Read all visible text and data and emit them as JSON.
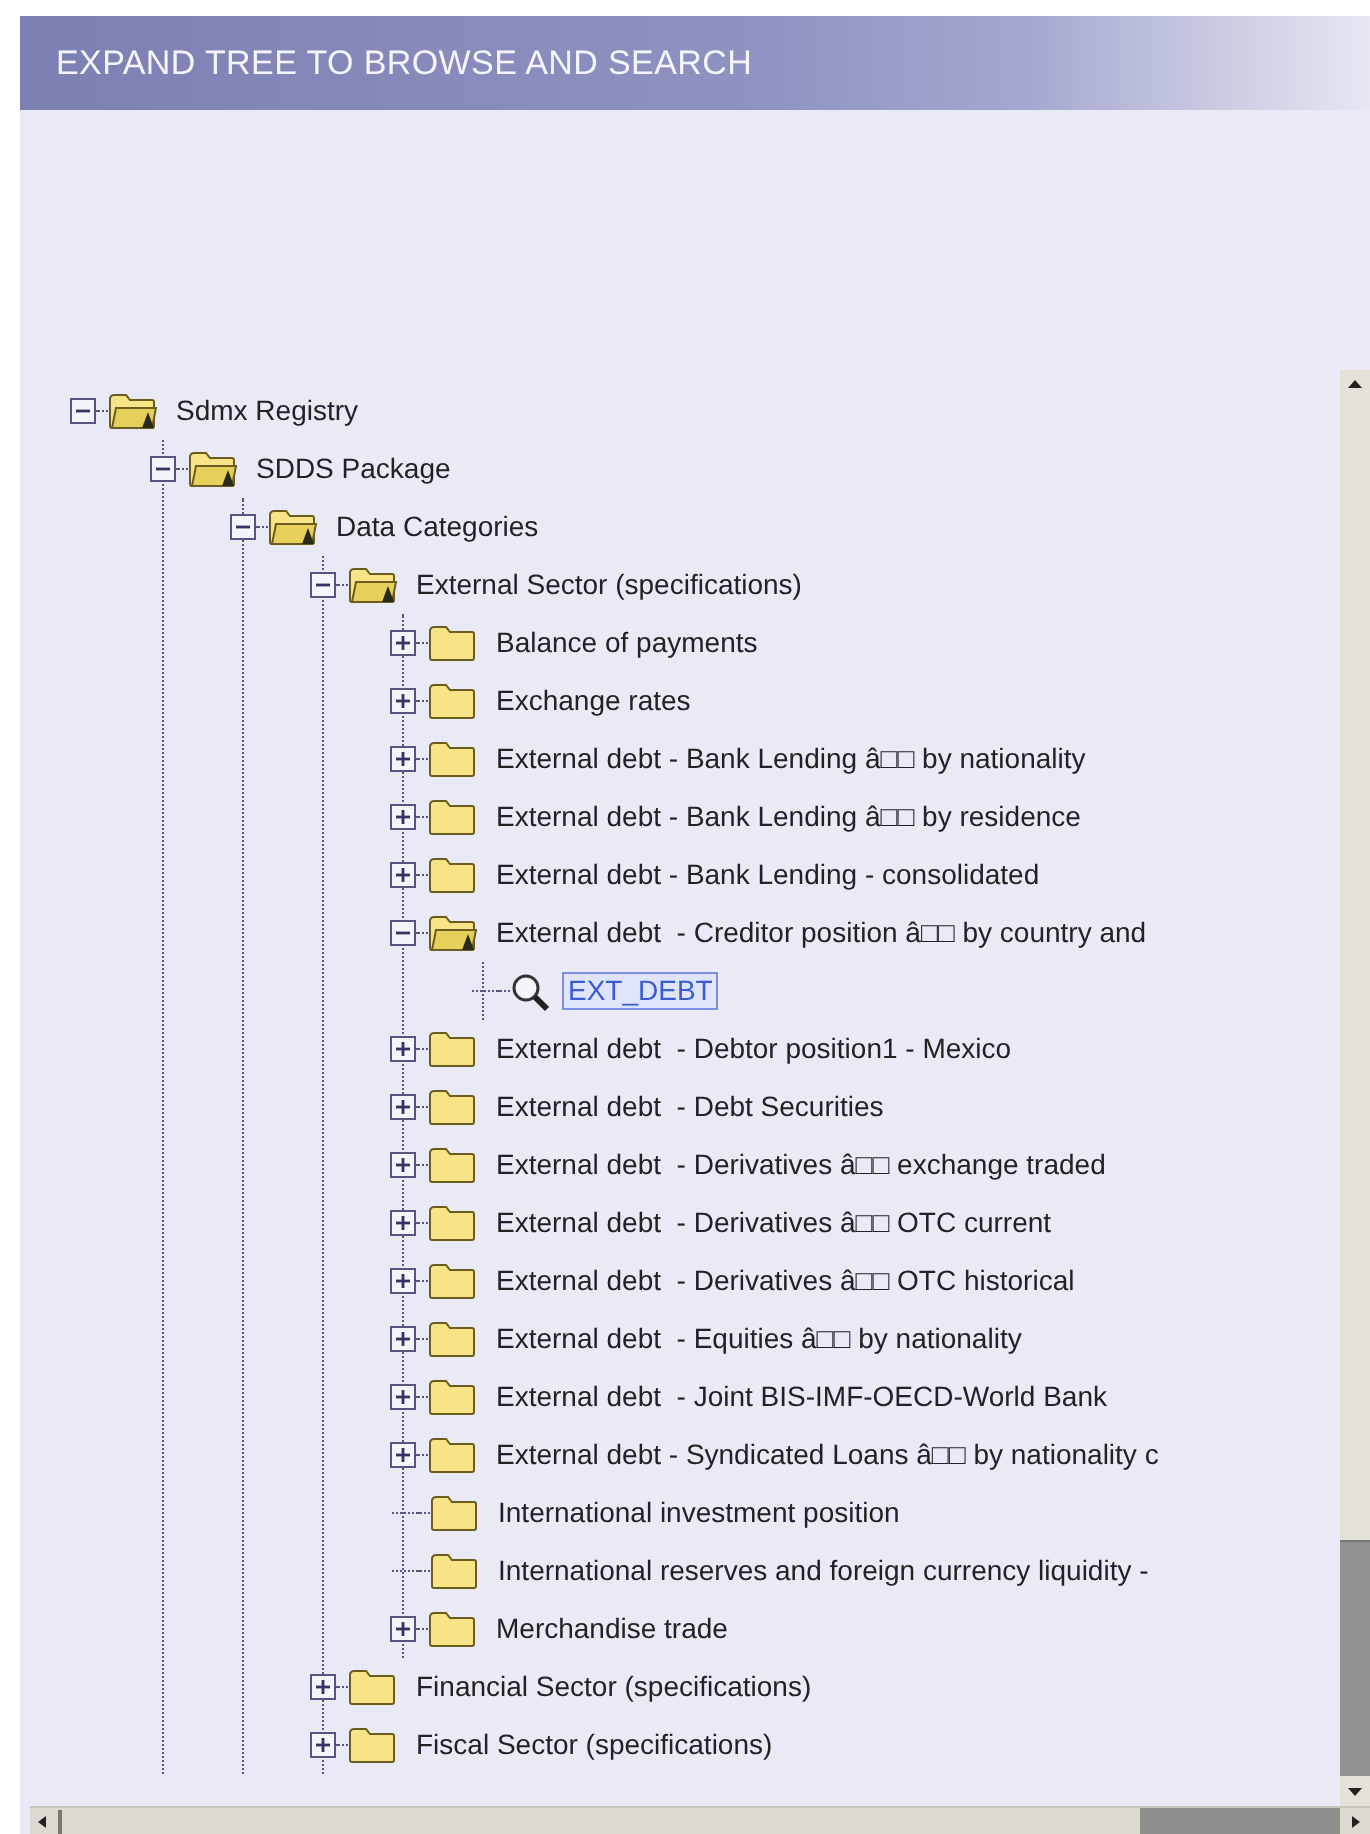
{
  "header": {
    "title": "EXPAND TREE TO BROWSE AND SEARCH"
  },
  "tree": [
    {
      "kind": "folder",
      "label": "Sdmx Registry",
      "expanded": true,
      "selected": false,
      "children": [
        {
          "kind": "folder",
          "label": "SDDS Package",
          "expanded": true,
          "selected": false,
          "children": [
            {
              "kind": "folder",
              "label": "Data Categories",
              "expanded": true,
              "selected": false,
              "children": [
                {
                  "kind": "folder",
                  "label": "External Sector (specifications)",
                  "expanded": true,
                  "selected": false,
                  "children": [
                    {
                      "kind": "folder",
                      "label": "Balance of payments",
                      "expanded": false,
                      "selected": false
                    },
                    {
                      "kind": "folder",
                      "label": "Exchange rates",
                      "expanded": false,
                      "selected": false
                    },
                    {
                      "kind": "folder",
                      "label": "External debt - Bank Lending â□□ by nationality",
                      "expanded": false,
                      "selected": false
                    },
                    {
                      "kind": "folder",
                      "label": "External debt - Bank Lending â□□ by residence",
                      "expanded": false,
                      "selected": false
                    },
                    {
                      "kind": "folder",
                      "label": "External debt - Bank Lending - consolidated",
                      "expanded": false,
                      "selected": false
                    },
                    {
                      "kind": "folder",
                      "label": "External debt  - Creditor position â□□ by country and",
                      "expanded": true,
                      "selected": false,
                      "children": [
                        {
                          "kind": "query",
                          "label": "EXT_DEBT",
                          "selected": true
                        }
                      ]
                    },
                    {
                      "kind": "folder",
                      "label": "External debt  - Debtor position1 - Mexico",
                      "expanded": false,
                      "selected": false
                    },
                    {
                      "kind": "folder",
                      "label": "External debt  - Debt Securities",
                      "expanded": false,
                      "selected": false
                    },
                    {
                      "kind": "folder",
                      "label": "External debt  - Derivatives â□□ exchange traded",
                      "expanded": false,
                      "selected": false
                    },
                    {
                      "kind": "folder",
                      "label": "External debt  - Derivatives â□□ OTC current",
                      "expanded": false,
                      "selected": false
                    },
                    {
                      "kind": "folder",
                      "label": "External debt  - Derivatives â□□ OTC historical",
                      "expanded": false,
                      "selected": false
                    },
                    {
                      "kind": "folder",
                      "label": "External debt  - Equities â□□ by nationality",
                      "expanded": false,
                      "selected": false
                    },
                    {
                      "kind": "folder",
                      "label": "External debt  - Joint BIS-IMF-OECD-World Bank",
                      "expanded": false,
                      "selected": false
                    },
                    {
                      "kind": "folder",
                      "label": "External debt - Syndicated Loans â□□ by nationality c",
                      "expanded": false,
                      "selected": false
                    },
                    {
                      "kind": "empty-folder",
                      "label": "International investment position",
                      "selected": false
                    },
                    {
                      "kind": "empty-folder",
                      "label": "International reserves and foreign currency liquidity -",
                      "selected": false
                    },
                    {
                      "kind": "folder",
                      "label": "Merchandise trade",
                      "expanded": false,
                      "selected": false
                    }
                  ]
                },
                {
                  "kind": "folder",
                  "label": "Financial Sector (specifications)",
                  "expanded": false,
                  "selected": false
                },
                {
                  "kind": "folder",
                  "label": "Fiscal Sector (specifications)",
                  "expanded": false,
                  "selected": false
                }
              ]
            }
          ]
        }
      ]
    }
  ]
}
